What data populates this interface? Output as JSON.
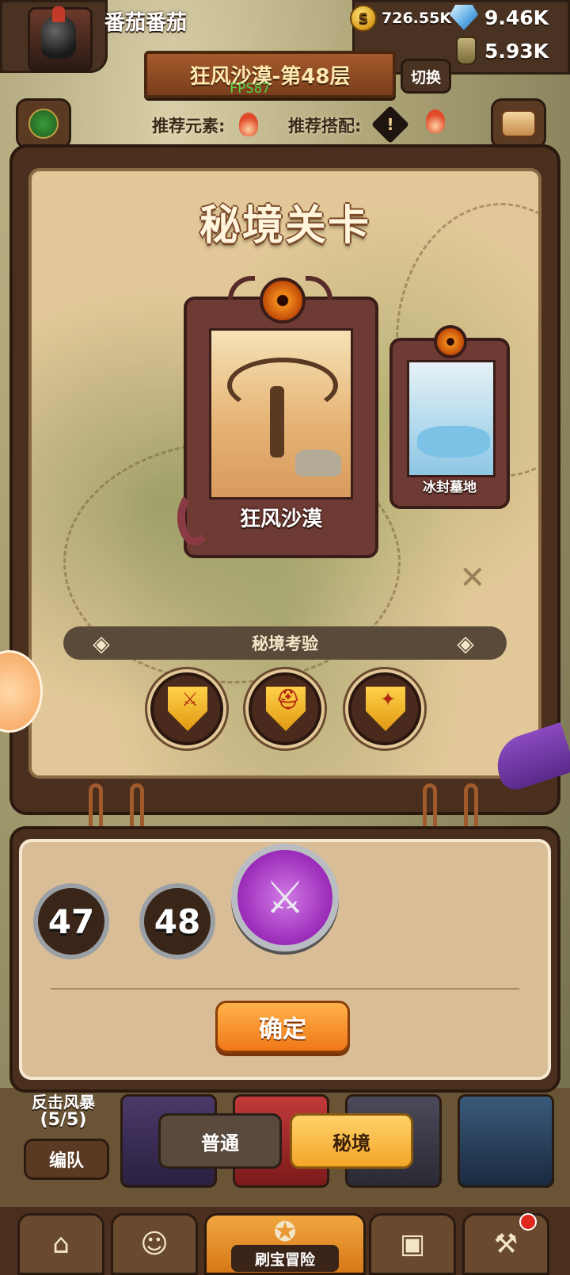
{
  "player": {
    "name": "番茄番茄"
  },
  "resources": {
    "coins": "726.55K",
    "gems": "9.46K",
    "potion": "5.93K"
  },
  "stage": {
    "title": "狂风沙漠-第48层",
    "fps": "FPS87",
    "switch_label": "切换",
    "recommend_element_label": "推荐元素:",
    "recommend_combo_label": "推荐搭配:",
    "warning_symbol": "!"
  },
  "book": {
    "title": "秘境关卡",
    "cards": [
      {
        "name": "狂风沙漠",
        "theme": "desert"
      },
      {
        "name": "冰封墓地",
        "theme": "ice"
      }
    ],
    "trial_label": "秘境考验",
    "trial_badges": [
      "attack-debuff-icon",
      "helmet-icon",
      "boot-icon"
    ]
  },
  "level_select": {
    "levels": [
      "47",
      "48"
    ],
    "current_icon": "crossed-swords-icon",
    "confirm_label": "确定"
  },
  "team": {
    "name_partial": "反击风暴",
    "count": "(5/5)",
    "edit_label": "编队"
  },
  "modes": {
    "normal": "普通",
    "secret": "秘境"
  },
  "nav": {
    "active_label": "刷宝冒险",
    "items": [
      "shop-icon",
      "hero-icon",
      "adventure-icon",
      "bag-icon",
      "forge-icon"
    ]
  },
  "colors": {
    "frame": "#4b2f1e",
    "page": "#e2c898",
    "confirm": "#f07818",
    "secret_mode": "#f3a628",
    "current_level": "#9a2ab8"
  }
}
